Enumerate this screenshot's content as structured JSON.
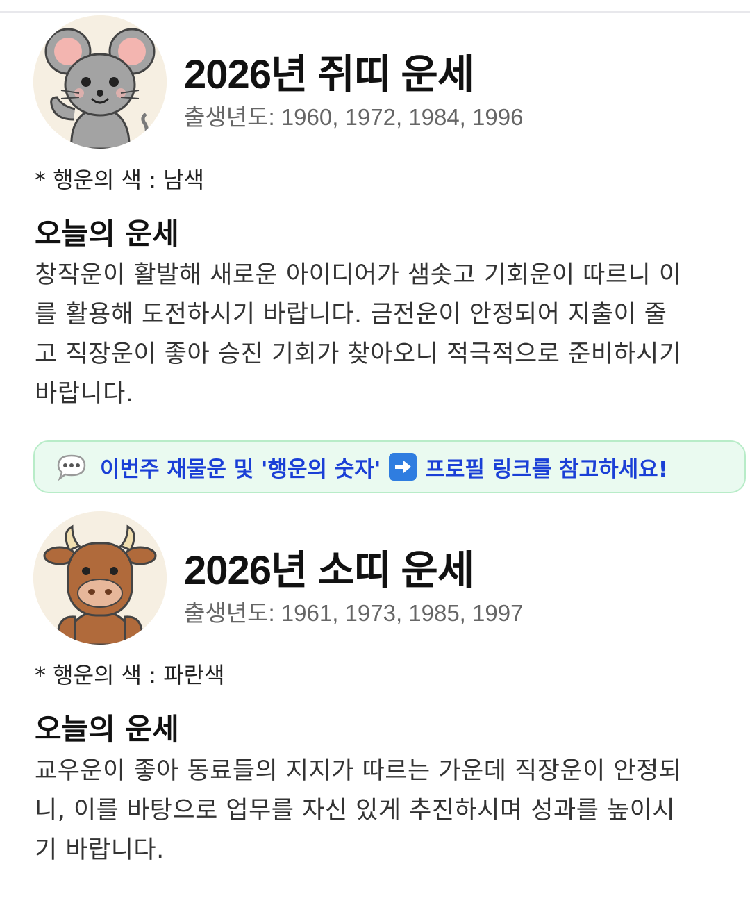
{
  "colors": {
    "accent_text": "#1a3fd6",
    "banner_bg": "#eafaf0",
    "banner_border": "#b8ecc8",
    "arrow_blue": "#2f7de0"
  },
  "sections": [
    {
      "avatar_icon": "mouse-icon",
      "title": "2026년 쥐띠 운세",
      "years": "출생년도: 1960, 1972, 1984, 1996",
      "lucky_color": "* 행운의 색 : 남색",
      "heading": "오늘의 운세",
      "lines": [
        "창작운이 활발해 새로운 아이디어가 샘솟고 기회운이 따르니 이",
        "를 활용해 도전하시기 바랍니다. 금전운이 안정되어 지출이 줄",
        "고 직장운이 좋아 승진 기회가 찾아오니 적극적으로 준비하시기",
        "바랍니다."
      ]
    },
    {
      "avatar_icon": "ox-icon",
      "title": "2026년 소띠 운세",
      "years": "출생년도: 1961, 1973, 1985, 1997",
      "lucky_color": "* 행운의 색 : 파란색",
      "heading": "오늘의 운세",
      "lines": [
        "교우운이 좋아 동료들의 지지가 따르는 가운데 직장운이 안정되",
        "니, 이를 바탕으로 업무를 자신 있게 추진하시며 성과를 높이시",
        "기 바랍니다."
      ]
    }
  ],
  "banner": {
    "bubble_icon": "speech-bubble-icon",
    "text_before": "이번주 재물운 및 '행운의 숫자'",
    "arrow_icon": "right-arrow-icon",
    "text_after": "프로필 링크를 참고하세요!"
  }
}
